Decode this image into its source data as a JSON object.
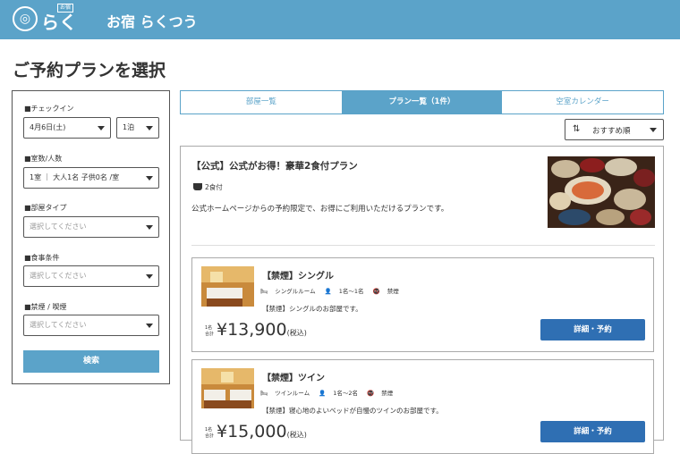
{
  "header": {
    "logo_text": "らくつう",
    "logo_tag": "お宿",
    "site_name": "お宿 らくつう"
  },
  "page_title": "ご予約プランを選択",
  "sidebar": {
    "checkin_label": "■チェックイン",
    "checkin_date": "4月6日(土)",
    "nights": "1泊",
    "rooms_label": "■室数/人数",
    "rooms_value": "1室 ｜ 大人1名 子供0名 /室",
    "room_type_label": "■部屋タイプ",
    "room_type_placeholder": "選択してください",
    "meal_label": "■食事条件",
    "meal_placeholder": "選択してください",
    "smoking_label": "■禁煙 / 喫煙",
    "smoking_placeholder": "選択してください",
    "search_label": "検索"
  },
  "tabs": [
    {
      "label": "部屋一覧",
      "active": false
    },
    {
      "label": "プラン一覧（1件）",
      "active": true
    },
    {
      "label": "空室カレンダー",
      "active": false
    }
  ],
  "sort": {
    "label": "おすすめ順",
    "icon": "sort-icon"
  },
  "plan": {
    "title": "【公式】公式がお得！豪華2食付プラン",
    "meal": "2食付",
    "description": "公式ホームページからの予約限定で、お得にご利用いただけるプランです。",
    "rooms": [
      {
        "name": "【禁煙】シングル",
        "room_type": "シングルルーム",
        "capacity": "1名～1名",
        "smoking": "禁煙",
        "note": "【禁煙】シングルのお部屋です。",
        "price_unit_1": "1名",
        "price_unit_2": "合計",
        "price": "¥13,900",
        "tax": "(税込)",
        "button": "詳細・予約"
      },
      {
        "name": "【禁煙】ツイン",
        "room_type": "ツインルーム",
        "capacity": "1名～2名",
        "smoking": "禁煙",
        "note": "【禁煙】寝心地のよいベッドが自慢のツインのお部屋です。",
        "price_unit_1": "1名",
        "price_unit_2": "合計",
        "price": "¥15,000",
        "tax": "(税込)",
        "button": "詳細・予約"
      }
    ]
  },
  "colors": {
    "brand": "#5ba3c9",
    "button": "#2f6fb3"
  }
}
